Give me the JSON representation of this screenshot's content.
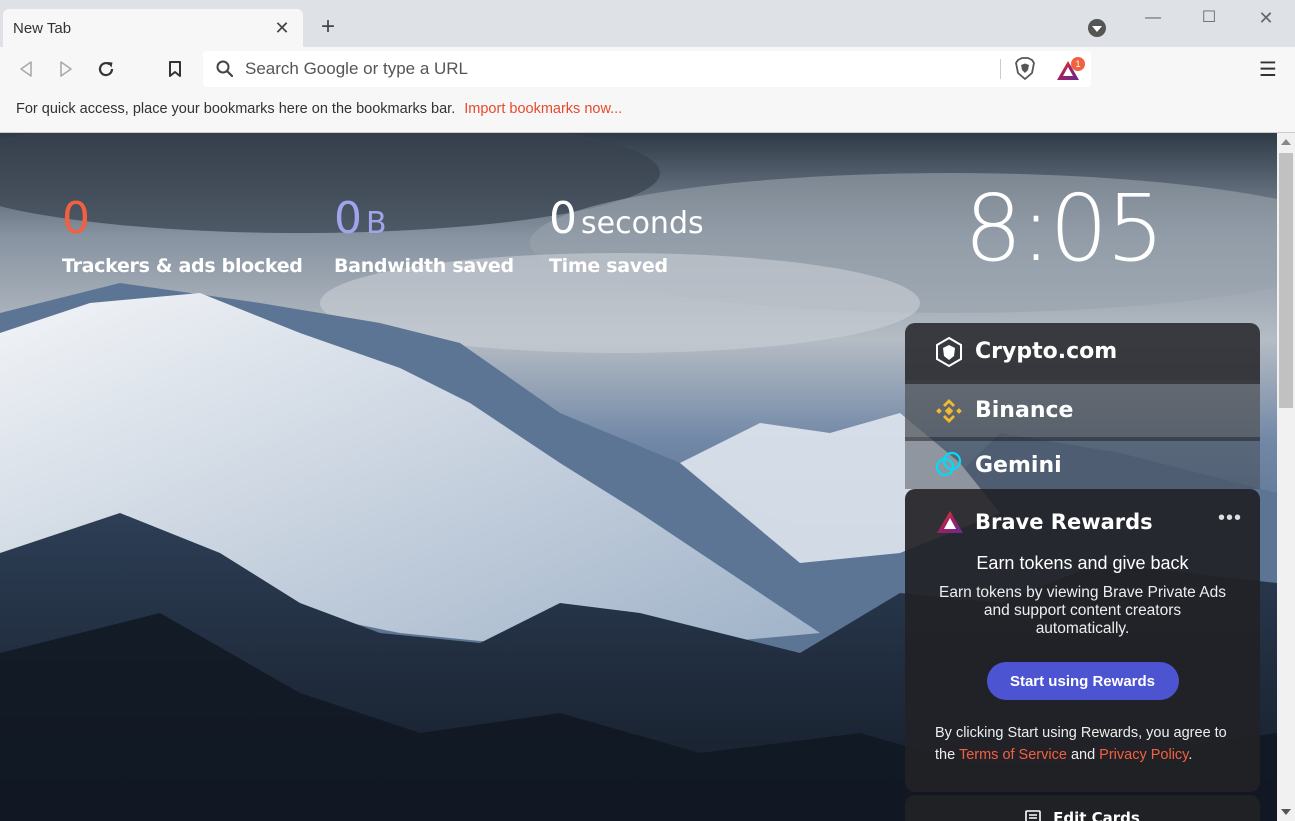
{
  "tab": {
    "title": "New Tab",
    "close": "✕",
    "new_tab": "+"
  },
  "window": {
    "minimize": "—",
    "maximize": "☐",
    "close": "✕"
  },
  "toolbar": {
    "url_placeholder": "Search Google or type a URL",
    "rewards_badge_count": "1",
    "menu_icon": "☰"
  },
  "bookmarks_bar": {
    "message": "For quick access, place your bookmarks here on the bookmarks bar.",
    "import_link": "Import bookmarks now..."
  },
  "stats": {
    "trackers": {
      "value": "0",
      "label": "Trackers & ads blocked"
    },
    "bandwidth": {
      "value": "0",
      "unit": "B",
      "label": "Bandwidth saved"
    },
    "time": {
      "value": "0",
      "unit": "seconds",
      "label": "Time saved"
    }
  },
  "clock": "8:05",
  "widgets": {
    "crypto": "Crypto.com",
    "binance": "Binance",
    "gemini": "Gemini"
  },
  "rewards_card": {
    "title": "Brave Rewards",
    "more": "•••",
    "headline": "Earn tokens and give back",
    "description": "Earn tokens by viewing Brave Private Ads and support content creators automatically.",
    "button": "Start using Rewards",
    "terms_prefix": "By clicking Start using Rewards, you agree to the ",
    "terms_link": "Terms of Service",
    "terms_and": " and ",
    "privacy_link": "Privacy Policy",
    "terms_suffix": "."
  },
  "edit_cards": "Edit Cards",
  "colors": {
    "accent_orange": "#f1613f",
    "bandwidth_purple": "#a0a5eb",
    "rewards_button": "#4c54d2",
    "binance_yellow": "#f3ba2f",
    "gemini_cyan": "#00dcfa"
  }
}
